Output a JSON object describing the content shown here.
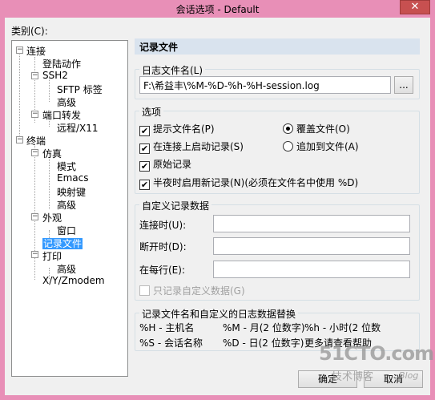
{
  "window": {
    "title": "会话选项 - Default",
    "close_symbol": "✕"
  },
  "category_label": "类别(C):",
  "tree": [
    {
      "label": "连接",
      "toggle": "−"
    },
    {
      "label": "登陆动作"
    },
    {
      "label": "SSH2",
      "toggle": "−"
    },
    {
      "label": "SFTP 标签"
    },
    {
      "label": "高级"
    },
    {
      "label": "端口转发",
      "toggle": "−"
    },
    {
      "label": "远程/X11"
    },
    {
      "label": "终端",
      "toggle": "−"
    },
    {
      "label": "仿真",
      "toggle": "−"
    },
    {
      "label": "模式"
    },
    {
      "label": "Emacs"
    },
    {
      "label": "映射键"
    },
    {
      "label": "高级"
    },
    {
      "label": "外观",
      "toggle": "−"
    },
    {
      "label": "窗口"
    },
    {
      "label": "记录文件",
      "selected": true
    },
    {
      "label": "打印",
      "toggle": "−"
    },
    {
      "label": "高级"
    },
    {
      "label": "X/Y/Zmodem"
    }
  ],
  "panel": {
    "header": "记录文件",
    "log_filename_group": "日志文件名(L)",
    "log_filename_value": "F:\\希益丰\\%M-%D-%h-%H-session.log",
    "browse_label": "...",
    "options_group": "选项",
    "options": {
      "prompt_filename": "提示文件名(P)",
      "start_on_connect": "在连接上启动记录(S)",
      "raw_log": "原始记录",
      "midnight_new_log": "半夜时启用新记录(N)(必须在文件名中使用 %D)",
      "overwrite": "覆盖文件(O)",
      "append": "追加到文件(A)"
    },
    "custom_group": "自定义记录数据",
    "custom_fields": {
      "on_connect_label": "连接时(U):",
      "on_disconnect_label": "断开时(D):",
      "on_each_line_label": "在每行(E):",
      "only_custom_label": "只记录自定义数据(G)"
    },
    "subst_group": "记录文件名和自定义的日志数据替换",
    "subst": {
      "r1c1": "%H - 主机名",
      "r1c2": "%M - 月(2 位数字)",
      "r1c3": "%h - 小时(2 位数",
      "r2c1": "%S - 会话名称",
      "r2c2": "%D - 日(2 位数字)",
      "r2c3": "更多请查看帮助"
    }
  },
  "buttons": {
    "ok": "确定",
    "cancel": "取消"
  },
  "watermark": {
    "main": "51CTO.com",
    "sub": "技术博客",
    "blog": "Blog"
  }
}
